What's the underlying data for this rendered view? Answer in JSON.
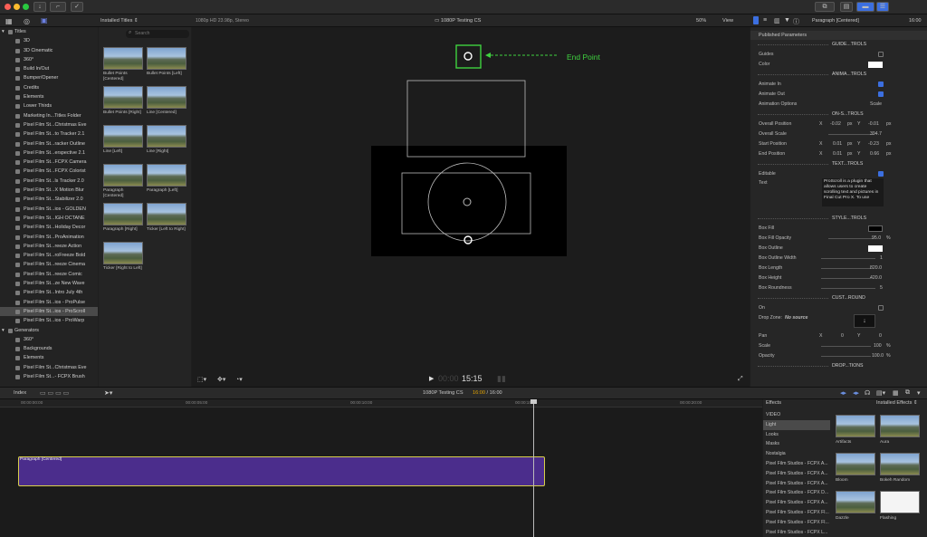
{
  "toolbar": {
    "right_label": "Paragraph [Centered]",
    "time": "16:00"
  },
  "browser": {
    "dropdown": "Installed Titles ⇕",
    "search_placeholder": "Search",
    "thumbs": [
      {
        "label": "Bullet Points [Centered]"
      },
      {
        "label": "Bullet Points [Left]"
      },
      {
        "label": "Bullet Points [Right]"
      },
      {
        "label": "Line [Centered]"
      },
      {
        "label": "Line [Left]"
      },
      {
        "label": "Line [Right]"
      },
      {
        "label": "Paragraph [Centered]"
      },
      {
        "label": "Paragraph [Left]"
      },
      {
        "label": "Paragraph [Right]"
      },
      {
        "label": "Ticker [Left to Right]"
      },
      {
        "label": "Ticker [Right to Left]"
      }
    ]
  },
  "viewer": {
    "format": "1080p HD 23.98p, Stereo",
    "project": "1080P Testing CS",
    "zoom": "50%",
    "view": "View",
    "annotation": "End Point",
    "timecode_dim": "00:00",
    "timecode": "15:15"
  },
  "library": {
    "titles_header": "Titles",
    "titles": [
      "3D",
      "3D Cinematic",
      "360°",
      "Build In/Out",
      "Bumper/Opener",
      "Credits",
      "Elements",
      "Lower Thirds",
      "Marketing In...Titles Folder",
      "Pixel Film St...Christmas Eve",
      "Pixel Film St...to Tracker 2.1",
      "Pixel Film St...racker Outline",
      "Pixel Film St...erspective 2.1",
      "Pixel Film St...FCPX Camera",
      "Pixel Film St...FCPX Colorist",
      "Pixel Film St...ls Tracker 2.0",
      "Pixel Film St...X Motion Blur",
      "Pixel Film St...Stabilizer 2.0",
      "Pixel Film St...ios - GOLDEN",
      "Pixel Film St...IGH OCTANE",
      "Pixel Film St...Holiday Decor",
      "Pixel Film St...ProAnimation",
      "Pixel Film St...reeze Action",
      "Pixel Film St...roFreeze Bold",
      "Pixel Film St...reeze Cinema",
      "Pixel Film St...reeze Comic",
      "Pixel Film St...ze New Wave",
      "Pixel Film St...Intro July 4th",
      "Pixel Film St...ios - ProPulse",
      "Pixel Film St...ios - ProScroll",
      "Pixel Film St...ios - ProWarp"
    ],
    "generators_header": "Generators",
    "generators": [
      "360°",
      "Backgrounds",
      "Elements",
      "Pixel Film St...Christmas Eve",
      "Pixel Film St...- FCPX Brush"
    ]
  },
  "inspector": {
    "published": "Published Parameters",
    "guides_section": "GUIDE...TROLS",
    "guides": "Guides",
    "color": "Color",
    "anim_section": "ANIMA...TROLS",
    "animate_in": "Animate In",
    "animate_out": "Animate Out",
    "anim_options": "Animation Options",
    "anim_options_val": "Scale",
    "onscreen_section": "ON-S...TROLS",
    "overall_position": "Overall Position",
    "op_x": "-0.02",
    "op_y": "-0.01",
    "overall_scale": "Overall Scale",
    "os_val": "394.7",
    "start_position": "Start Position",
    "sp_x": "0.01",
    "sp_y": "-0.23",
    "end_position": "End Position",
    "ep_x": "0.01",
    "ep_y": "0.66",
    "text_section": "TEXT...TROLS",
    "editable": "Editable",
    "text": "Text",
    "text_value": "ProScroll is a plugin that allows users to create scrolling text and pictures in Final Cut Pro X. To use",
    "style_section": "STYLE...TROLS",
    "box_fill": "Box Fill",
    "box_fill_opacity": "Box Fill Opacity",
    "bfo_val": "95.0",
    "box_outline": "Box Outline",
    "box_outline_width": "Box Outline Width",
    "bow_val": "1",
    "box_length": "Box Length",
    "bl_val": "820.0",
    "box_height": "Box Height",
    "bh_val": "420.0",
    "box_roundness": "Box Roundness",
    "br_val": "5",
    "cust_section": "CUST...ROUND",
    "on": "On",
    "drop_zone": "Drop Zone:",
    "no_source": "No source",
    "pan": "Pan",
    "pan_x": "0",
    "pan_y": "0",
    "scale": "Scale",
    "scale_val": "100",
    "opacity": "Opacity",
    "opacity_val": "100.0",
    "drop_section": "DROP...TIONS",
    "px": "px",
    "pct": "%",
    "x": "X",
    "y": "Y"
  },
  "timeline": {
    "index": "Index",
    "project": "1080P Testing CS",
    "tc_current": "16:00",
    "tc_total": "16:00",
    "clip": "Paragraph [Centered]",
    "ruler": [
      "00:00:00:00",
      "00:00:05:00",
      "00:00:10:00",
      "00:00:15:00",
      "00:00:20:00"
    ]
  },
  "effects": {
    "header": "Effects",
    "installed": "Installed Effects ⇕",
    "cats": [
      "VIDEO",
      "Light",
      "Looks",
      "Masks",
      "Nostalgia",
      "Pixel Film Studios - FCPX A...",
      "Pixel Film Studios - FCPX A...",
      "Pixel Film Studios - FCPX A...",
      "Pixel Film Studios - FCPX D...",
      "Pixel Film Studios - FCPX A...",
      "Pixel Film Studios - FCPX Fl...",
      "Pixel Film Studios - FCPX Fl...",
      "Pixel Film Studios - FCPX L..."
    ],
    "thumbs": [
      {
        "label": "Artifacts"
      },
      {
        "label": "Aura"
      },
      {
        "label": "Bloom"
      },
      {
        "label": "Bokeh Random"
      },
      {
        "label": "Dazzle"
      },
      {
        "label": "Flashing"
      }
    ]
  },
  "colors": {
    "accent": "#3c6fe0",
    "clip": "#4b2d8c",
    "clip_border": "#d8d04a",
    "annotation": "#3fd23f",
    "timecode": "#e6a500"
  }
}
